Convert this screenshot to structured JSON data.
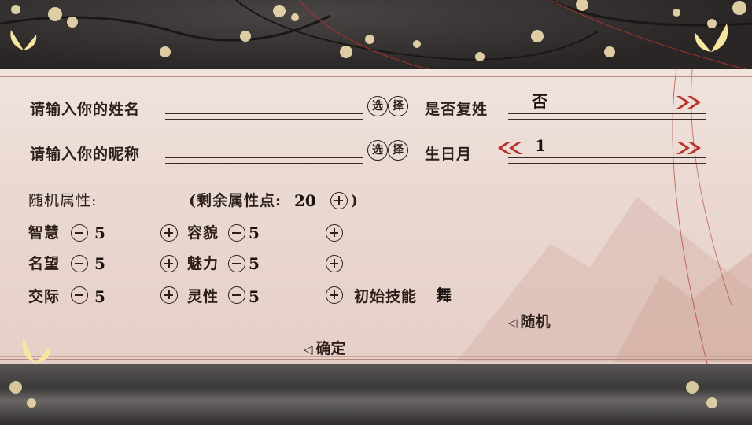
{
  "form": {
    "surname_label": "请输入你的姓名",
    "surname_value": "",
    "nickname_label": "请输入你的昵称",
    "nickname_value": "",
    "select_char_1": "选",
    "select_char_2": "择",
    "compound_surname_label": "是否复姓",
    "compound_surname_value": "否",
    "birth_month_label": "生日月",
    "birth_month_value": "1"
  },
  "attributes": {
    "header_label": "随机属性:",
    "remaining_label": "(剩余属性点:",
    "remaining_value": "20",
    "remaining_close": ")",
    "items": [
      {
        "name": "智慧",
        "value": "5"
      },
      {
        "name": "容貌",
        "value": "5"
      },
      {
        "name": "名望",
        "value": "5"
      },
      {
        "name": "魅力",
        "value": "5"
      },
      {
        "name": "交际",
        "value": "5"
      },
      {
        "name": "灵性",
        "value": "5"
      }
    ],
    "initial_skill_label": "初始技能",
    "initial_skill_value": "舞"
  },
  "actions": {
    "random_label": "随机",
    "confirm_label": "确定"
  },
  "colors": {
    "arrow_red": "#b8322a",
    "text_dark": "#2b1f1a"
  }
}
